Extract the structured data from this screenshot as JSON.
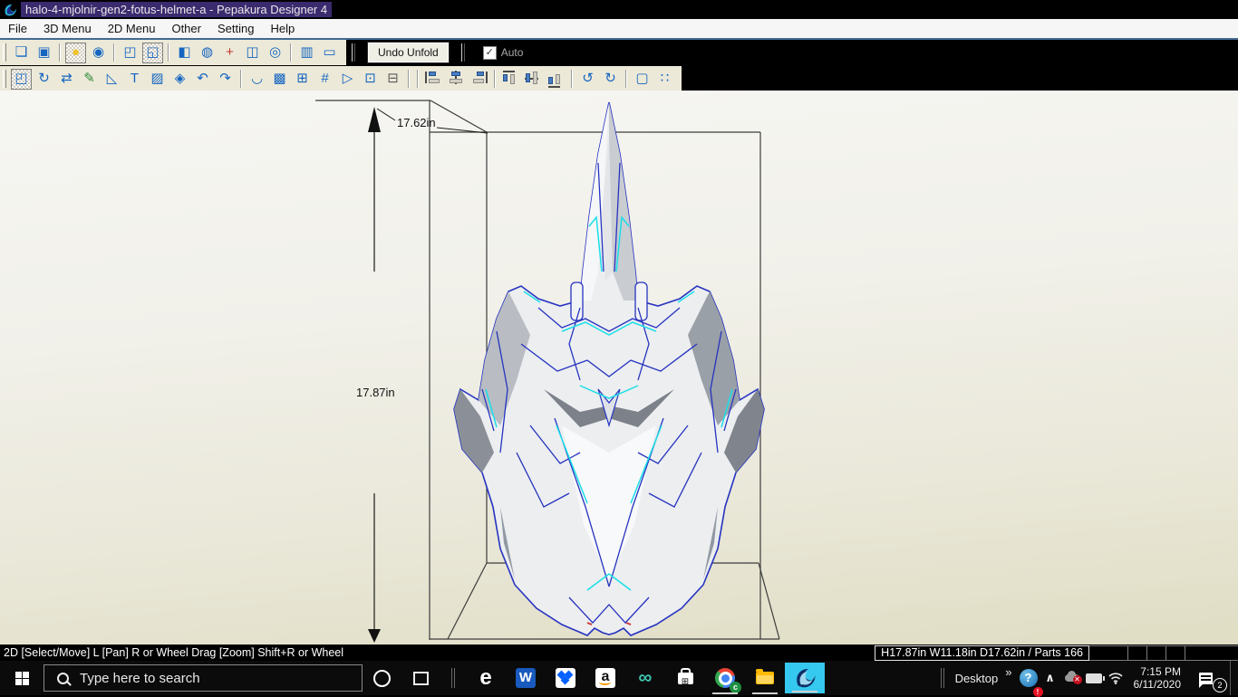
{
  "window": {
    "title": "halo-4-mjolnir-gen2-fotus-helmet-a - Pepakura Designer 4",
    "app_name": "Pepakura Designer 4"
  },
  "menubar": {
    "items": [
      "File",
      "3D Menu",
      "2D Menu",
      "Other",
      "Setting",
      "Help"
    ]
  },
  "toolbars": {
    "row1": [
      {
        "t": "grip"
      },
      {
        "t": "i",
        "n": "open-file-icon",
        "g": "❏"
      },
      {
        "t": "i",
        "n": "save-file-icon",
        "g": "▣"
      },
      {
        "t": "s"
      },
      {
        "t": "i",
        "n": "light-render-toggle-icon",
        "g": "●",
        "c": "#f2c12e",
        "p": 1
      },
      {
        "t": "i",
        "n": "view-control-icon",
        "g": "◉"
      },
      {
        "t": "s"
      },
      {
        "t": "i",
        "n": "select-3d-icon",
        "g": "◰"
      },
      {
        "t": "i",
        "n": "select-face-3d-icon",
        "g": "◱",
        "p": 1
      },
      {
        "t": "s"
      },
      {
        "t": "i",
        "n": "texture-paint-icon",
        "g": "◧"
      },
      {
        "t": "i",
        "n": "solid-view-icon",
        "g": "◍"
      },
      {
        "t": "i",
        "n": "axis-icon",
        "g": "+",
        "c": "#c0392b"
      },
      {
        "t": "i",
        "n": "split-3d-2d-icon",
        "g": "◫"
      },
      {
        "t": "i",
        "n": "display-settings-icon",
        "g": "◎"
      },
      {
        "t": "s"
      },
      {
        "t": "i",
        "n": "two-pane-layout-icon",
        "g": "▥"
      },
      {
        "t": "i",
        "n": "one-pane-layout-icon",
        "g": "▭"
      }
    ],
    "row1_controls": {
      "undo_unfold_label": "Undo Unfold",
      "auto_label": "Auto",
      "auto_checked": true,
      "check_glyph": "✓"
    },
    "row2": [
      {
        "t": "grip"
      },
      {
        "t": "i",
        "n": "select-move-2d-icon",
        "g": "◰",
        "p": 1
      },
      {
        "t": "i",
        "n": "rotate-part-icon",
        "g": "↻"
      },
      {
        "t": "i",
        "n": "join-divide-icon",
        "g": "⇄"
      },
      {
        "t": "i",
        "n": "edit-line-icon",
        "g": "✎",
        "c": "#2e8b3a"
      },
      {
        "t": "i",
        "n": "erase-line-icon",
        "g": "◺"
      },
      {
        "t": "i",
        "n": "text-tool-icon",
        "g": "T"
      },
      {
        "t": "i",
        "n": "image-tool-icon",
        "g": "▨"
      },
      {
        "t": "i",
        "n": "box-3d-icon",
        "g": "◈"
      },
      {
        "t": "i",
        "n": "undo-icon",
        "g": "↶"
      },
      {
        "t": "i",
        "n": "redo-icon",
        "g": "↷"
      },
      {
        "t": "s"
      },
      {
        "t": "i",
        "n": "unfold-book-icon",
        "g": "◡"
      },
      {
        "t": "i",
        "n": "select-pattern-icon",
        "g": "▩"
      },
      {
        "t": "i",
        "n": "arrange-parts-icon",
        "g": "⊞"
      },
      {
        "t": "i",
        "n": "page-number-icon",
        "g": "#"
      },
      {
        "t": "i",
        "n": "export-page-icon",
        "g": "▷"
      },
      {
        "t": "i",
        "n": "paste-clipboard-icon",
        "g": "⊡"
      },
      {
        "t": "i",
        "n": "print-icon",
        "g": "⊟",
        "c": "#5a5a5a"
      },
      {
        "t": "s"
      },
      {
        "t": "s"
      },
      {
        "t": "al",
        "k": "l",
        "n": "align-left-icon"
      },
      {
        "t": "al",
        "k": "ch",
        "n": "align-center-horizontal-icon"
      },
      {
        "t": "al",
        "k": "r",
        "n": "align-right-icon"
      },
      {
        "t": "s"
      },
      {
        "t": "al",
        "k": "t",
        "n": "align-top-icon"
      },
      {
        "t": "al",
        "k": "cv",
        "n": "align-center-vertical-icon"
      },
      {
        "t": "al",
        "k": "b",
        "n": "align-bottom-icon"
      },
      {
        "t": "s"
      },
      {
        "t": "i",
        "n": "rotate-left-icon",
        "g": "↺"
      },
      {
        "t": "i",
        "n": "rotate-right-icon",
        "g": "↻"
      },
      {
        "t": "s"
      },
      {
        "t": "i",
        "n": "group-parts-icon",
        "g": "▢"
      },
      {
        "t": "i",
        "n": "edit-points-icon",
        "g": "∷"
      }
    ]
  },
  "viewport": {
    "depth_label": "17.62in",
    "height_label": "17.87in",
    "colors": {
      "background_top": "#f6f6f3",
      "background_bottom": "#e0ddc4",
      "box_line": "#3c3c3c",
      "edge_blue": "#2633c0",
      "edge_cyan": "#19dfe8",
      "face_light": "#eceef0",
      "face_shade": "#9aa0a7"
    }
  },
  "statusbar": {
    "left": "2D [Select/Move] L [Pan] R or Wheel Drag [Zoom] Shift+R or Wheel",
    "right": "H17.87in W11.18in D17.62in / Parts 166"
  },
  "taskbar": {
    "search_placeholder": "Type here to search",
    "edge_glyph": "e",
    "word_glyph": "W",
    "amazon_glyph": "a",
    "infinity_glyph": "∞",
    "store_glyph": "⊞",
    "chrome_badge": "c",
    "desktop_label": "Desktop",
    "overflow_chevron": "»",
    "help_glyph": "?",
    "help_badge": "!",
    "hidden_icons_chevron": "∧",
    "onedrive_badge": "✕",
    "clock": {
      "time": "7:15 PM",
      "date": "6/11/2020"
    },
    "notification_count": "2",
    "accent_active_app": "#35c9f0"
  }
}
